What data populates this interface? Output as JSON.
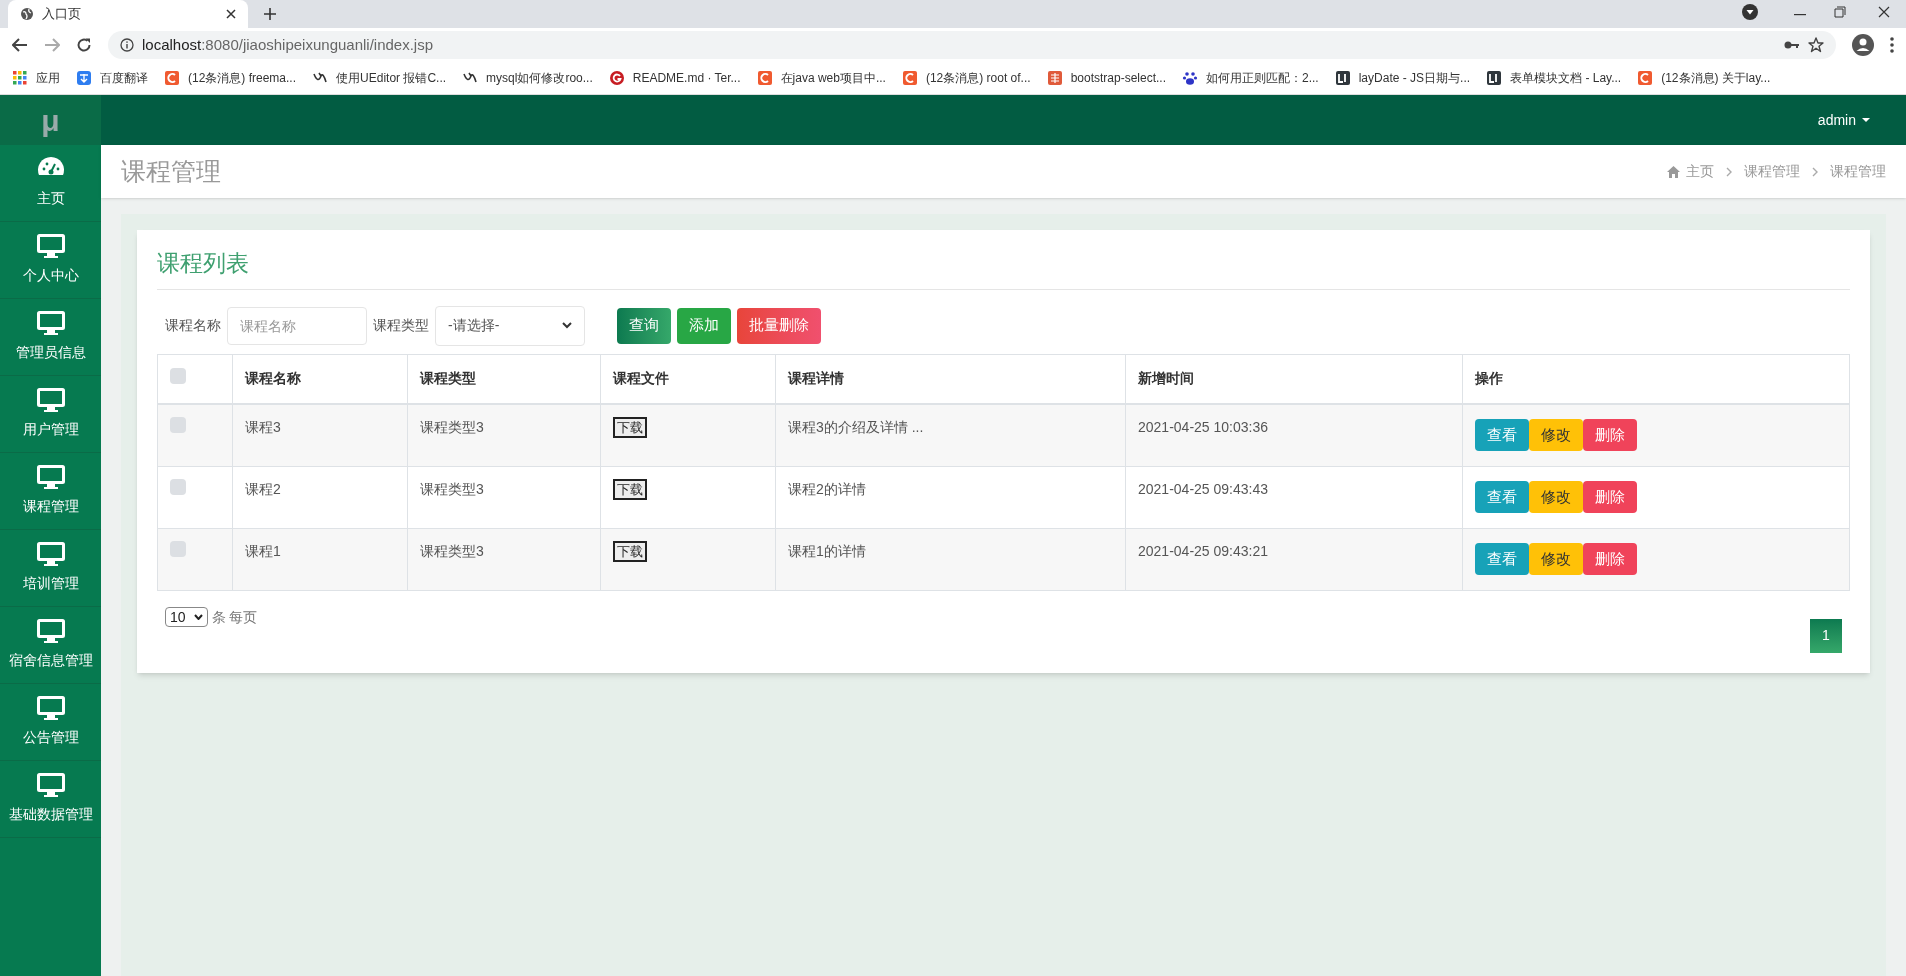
{
  "browser": {
    "tab_title": "入口页",
    "url_host": "localhost",
    "url_rest": ":8080/jiaoshipeixunguanli/index.jsp",
    "bookmarks": [
      {
        "kind": "apps",
        "label": "应用"
      },
      {
        "kind": "translate",
        "label": "百度翻译"
      },
      {
        "kind": "c",
        "label": "(12条消息) freema..."
      },
      {
        "kind": "ue",
        "label": "使用UEditor 报错C..."
      },
      {
        "kind": "ue",
        "label": "mysql如何修改roo..."
      },
      {
        "kind": "g",
        "label": "README.md · Ter..."
      },
      {
        "kind": "c",
        "label": "在java web项目中..."
      },
      {
        "kind": "c",
        "label": "(12条消息) root of..."
      },
      {
        "kind": "jian",
        "label": "bootstrap-select..."
      },
      {
        "kind": "baidu",
        "label": "如何用正则匹配：2..."
      },
      {
        "kind": "lay",
        "label": "layDate - JS日期与..."
      },
      {
        "kind": "lay",
        "label": "表单模块文档 - Lay..."
      },
      {
        "kind": "c",
        "label": "(12条消息) 关于lay..."
      }
    ]
  },
  "app": {
    "logo": "μ",
    "user": "admin"
  },
  "sidebar": {
    "items": [
      {
        "kind": "dashboard",
        "label": "主页"
      },
      {
        "kind": "monitor",
        "label": "个人中心"
      },
      {
        "kind": "monitor",
        "label": "管理员信息"
      },
      {
        "kind": "monitor",
        "label": "用户管理"
      },
      {
        "kind": "monitor",
        "label": "课程管理"
      },
      {
        "kind": "monitor",
        "label": "培训管理"
      },
      {
        "kind": "monitor",
        "label": "宿舍信息管理"
      },
      {
        "kind": "monitor",
        "label": "公告管理"
      },
      {
        "kind": "monitor",
        "label": "基础数据管理"
      }
    ]
  },
  "page_title": "课程管理",
  "breadcrumb": [
    "主页",
    "课程管理",
    "课程管理"
  ],
  "card_title": "课程列表",
  "filters": [
    {
      "kind": "input",
      "label": "课程名称",
      "placeholder": "课程名称"
    },
    {
      "kind": "select",
      "label": "课程类型",
      "value": "-请选择-"
    }
  ],
  "buttons": [
    {
      "kind": "search",
      "label": "查询"
    },
    {
      "kind": "add",
      "label": "添加"
    },
    {
      "kind": "delete",
      "label": "批量删除"
    }
  ],
  "table": {
    "columns": [
      "课程名称",
      "课程类型",
      "课程文件",
      "课程详情",
      "新增时间",
      "操作"
    ],
    "header_checked": false,
    "rows": [
      {
        "checked": false,
        "cells": [
          "课程3",
          "课程类型3",
          "下载",
          "课程3的介绍及详情 ...",
          "2021-04-25 10:03:36"
        ],
        "actions": [
          {
            "kind": "view",
            "label": "查看"
          },
          {
            "kind": "edit",
            "label": "修改"
          },
          {
            "kind": "delete",
            "label": "删除"
          }
        ]
      },
      {
        "checked": false,
        "cells": [
          "课程2",
          "课程类型3",
          "下载",
          "课程2的详情",
          "2021-04-25 09:43:43"
        ],
        "actions": [
          {
            "kind": "view",
            "label": "查看"
          },
          {
            "kind": "edit",
            "label": "修改"
          },
          {
            "kind": "delete",
            "label": "删除"
          }
        ]
      },
      {
        "checked": false,
        "cells": [
          "课程1",
          "课程类型3",
          "下载",
          "课程1的详情",
          "2021-04-25 09:43:21"
        ],
        "actions": [
          {
            "kind": "view",
            "label": "查看"
          },
          {
            "kind": "edit",
            "label": "修改"
          },
          {
            "kind": "delete",
            "label": "删除"
          }
        ]
      }
    ]
  },
  "pagination": {
    "page_size": "10",
    "page_size_suffix": "条 每页",
    "pages": [
      {
        "label": "1",
        "selected": true
      }
    ]
  }
}
